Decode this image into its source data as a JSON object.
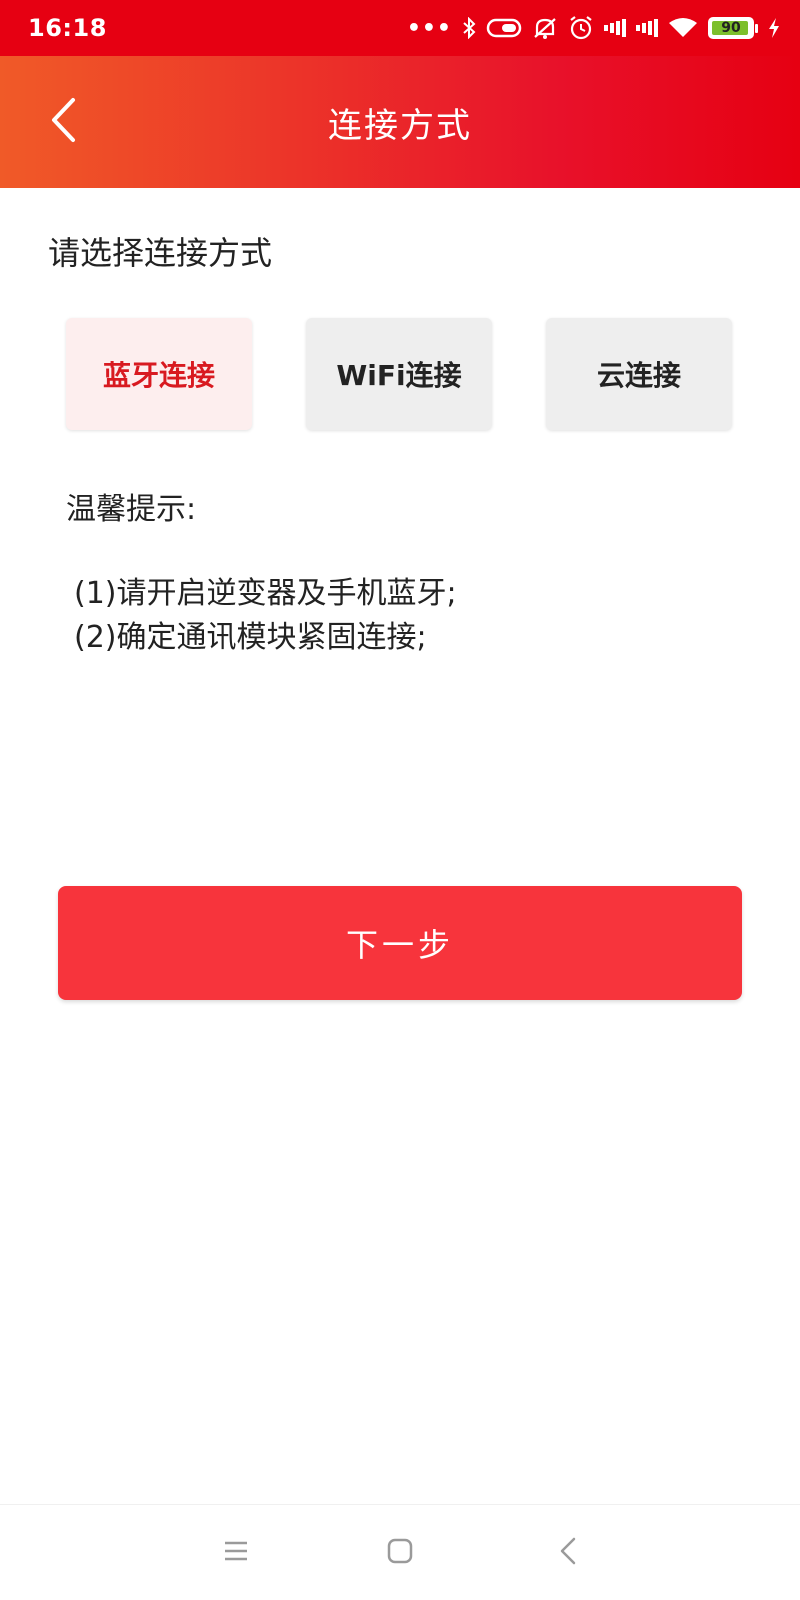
{
  "status_bar": {
    "time": "16:18",
    "dots": "•••",
    "battery_level": "90",
    "icons": [
      "bluetooth-icon",
      "vibrate-icon",
      "mute-icon",
      "alarm-icon",
      "signal-icon",
      "signal-icon",
      "wifi-icon",
      "battery-icon",
      "charging-icon"
    ]
  },
  "header": {
    "title": "连接方式",
    "back_icon": "chevron-left-icon"
  },
  "content": {
    "prompt": "请选择连接方式",
    "options": [
      {
        "label": "蓝牙连接",
        "selected": true
      },
      {
        "label": "WiFi连接",
        "selected": false
      },
      {
        "label": "云连接",
        "selected": false
      }
    ],
    "tips_title": "温馨提示:",
    "tips": [
      "(1)请开启逆变器及手机蓝牙;",
      "(2)确定通讯模块紧固连接;"
    ],
    "next_label": "下一步"
  },
  "colors": {
    "accent": "#e60012",
    "button": "#f7343c",
    "selected_text": "#d81a20",
    "selected_bg": "#fdeeee"
  },
  "nav_bar": {
    "icons": [
      "menu-icon",
      "home-icon",
      "back-icon"
    ]
  }
}
